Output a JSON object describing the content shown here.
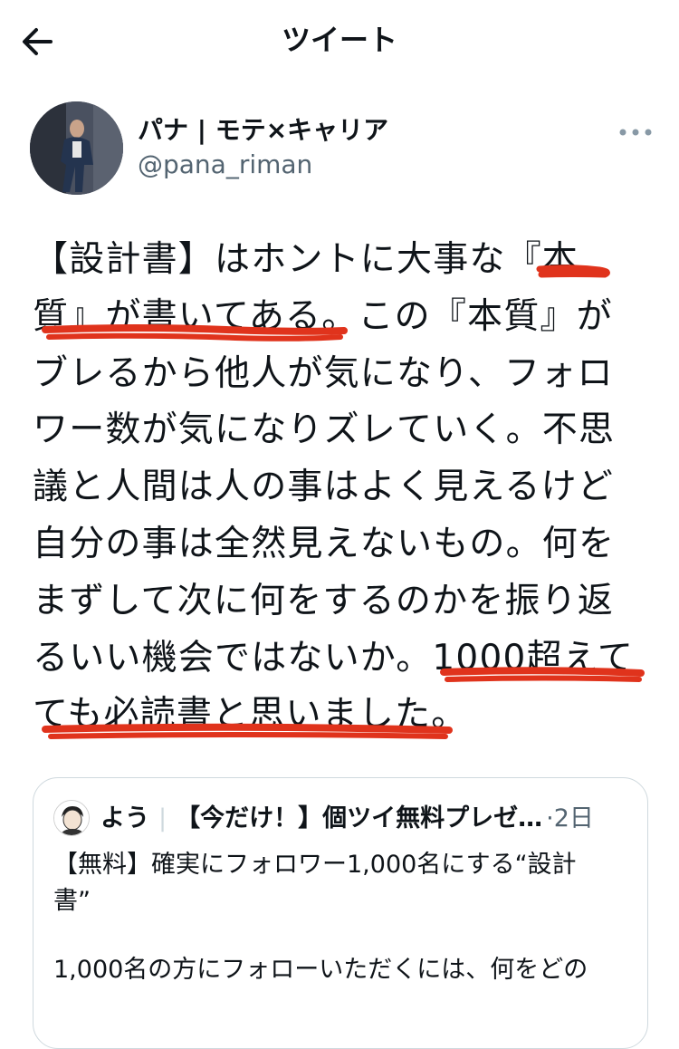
{
  "header": {
    "title": "ツイート"
  },
  "author": {
    "name": "パナ | モテ×キャリア",
    "handle": "@pana_riman"
  },
  "tweet": {
    "lines": [
      "【設計書】はホントに大事な『本",
      "質』が書いてある。この『本質』が",
      "ブレるから他人が気になり、フォロ",
      "ワー数が気になりズレていく。不思",
      "議と人間は人の事はよく見えるけど",
      "自分の事は全然見えないもの。何を",
      "まずして次に何をするのかを振り返",
      "るいい機会ではないか。1000超えて",
      "ても必読書と思いました。"
    ]
  },
  "quote": {
    "name": "よう",
    "separator": "|",
    "bio": "【今だけ！】個ツイ無料プレゼ…",
    "dot": "·",
    "date": "2日",
    "title_line1": "【無料】確実にフォロワー1,000名にする“設計",
    "title_line2": "書”",
    "text_line1": "1,000名の方にフォローいただくには、何をどの"
  },
  "colors": {
    "text": "#0f1419",
    "secondary": "#536471",
    "border": "#cfd9de",
    "scribble": "#e0331c"
  },
  "icons": {
    "back": "arrow-left-icon",
    "more": "more-dots-icon"
  }
}
